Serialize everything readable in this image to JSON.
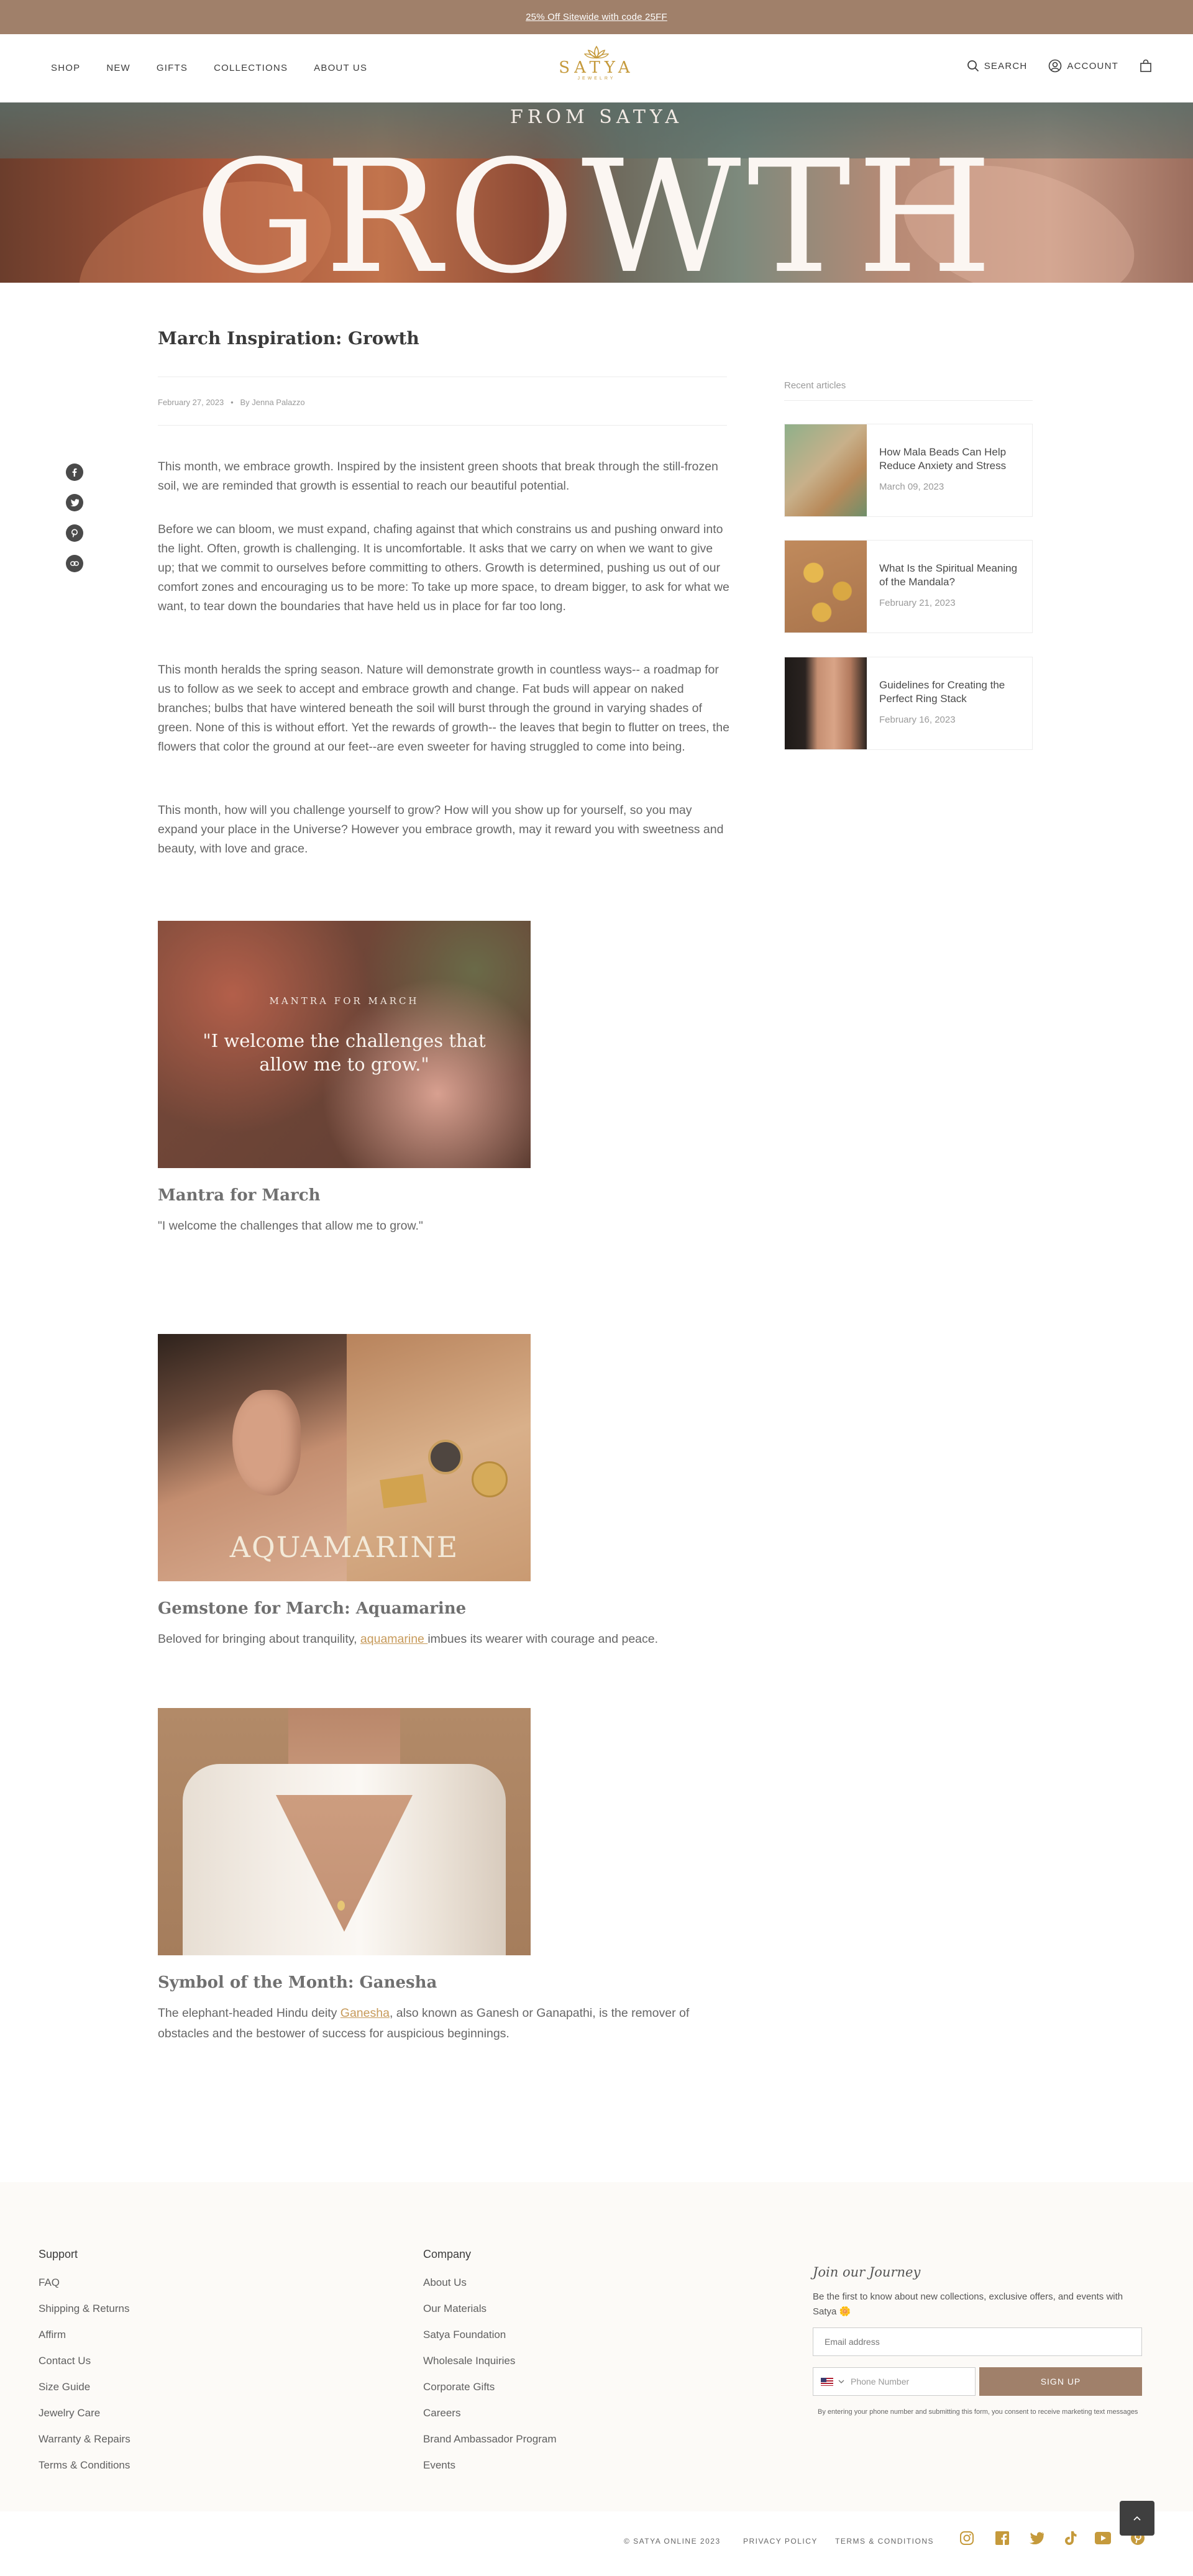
{
  "announcement": {
    "text": "25% Off Sitewide with code 25FF"
  },
  "nav": {
    "left": [
      "SHOP",
      "NEW",
      "GIFTS",
      "COLLECTIONS",
      "ABOUT US"
    ],
    "logo": {
      "name": "SATYA",
      "sub": "JEWELRY"
    },
    "search_label": "SEARCH",
    "account_label": "ACCOUNT"
  },
  "hero": {
    "eyebrow": "FROM SATYA",
    "title": "GROWTH"
  },
  "article": {
    "title": "March Inspiration: Growth",
    "date": "February 27, 2023",
    "author": "By Jenna Palazzo",
    "paragraphs": [
      "This month, we embrace growth. Inspired by the insistent green shoots that break through the still-frozen soil, we are reminded that growth is essential to reach our beautiful potential.",
      "Before we can bloom, we must expand, chafing against that which constrains us and pushing onward into the light. Often, growth is challenging. It is uncomfortable. It asks that we carry on when we want to give up; that we commit to ourselves before committing to others. Growth is determined, pushing us out of our comfort zones and encouraging us to be more: To take up more space, to dream bigger, to ask for what we want, to tear down the boundaries that have held us in place for far too long.",
      "This month heralds the spring season. Nature will demonstrate growth in countless ways-- a roadmap for us to follow as we seek to accept and embrace growth and change. Fat buds will appear on naked branches; bulbs that have wintered beneath the soil will burst through the ground in varying shades of green. None of this is without effort. Yet the rewards of growth-- the leaves that begin to flutter on trees, the flowers that color the ground at our feet--are even sweeter for having struggled to come into being.",
      "This month, how will you challenge yourself to grow? How will you show up for yourself, so you may expand your place in the Universe? However you embrace growth, may it reward you with sweetness and beauty, with love and grace."
    ],
    "mantra_image": {
      "kicker": "MANTRA FOR MARCH",
      "quote": "\"I welcome the challenges that allow me to grow.\""
    },
    "mantra": {
      "heading": "Mantra for March",
      "text": "\"I welcome the challenges that allow me to grow.\""
    },
    "gem_image_word": "AQUAMARINE",
    "gem": {
      "heading": "Gemstone for March: Aquamarine",
      "pre": "Beloved for bringing about tranquility, ",
      "link": "aquamarine ",
      "post": "imbues its wearer with courage and peace."
    },
    "symbol": {
      "heading": "Symbol of the Month: Ganesha",
      "pre": "The elephant-headed Hindu deity ",
      "link": "Ganesha",
      "post": ", also known as Ganesh or Ganapathi, is the remover of obstacles and the bestower of success for auspicious beginnings."
    }
  },
  "sidebar": {
    "title": "Recent articles",
    "articles": [
      {
        "title": "How Mala Beads Can Help Reduce Anxiety and Stress",
        "date": "March 09, 2023"
      },
      {
        "title": "What Is the Spiritual Meaning of the Mandala?",
        "date": "February 21, 2023"
      },
      {
        "title": "Guidelines for Creating the Perfect Ring Stack",
        "date": "February 16, 2023"
      }
    ]
  },
  "footer": {
    "support": {
      "heading": "Support",
      "links": [
        "FAQ",
        "Shipping & Returns",
        "Affirm",
        "Contact Us",
        "Size Guide",
        "Jewelry Care",
        "Warranty & Repairs",
        "Terms & Conditions"
      ]
    },
    "company": {
      "heading": "Company",
      "links": [
        "About Us",
        "Our Materials",
        "Satya Foundation",
        "Wholesale Inquiries",
        "Corporate Gifts",
        "Careers",
        "Brand Ambassador Program",
        "Events"
      ]
    },
    "join": {
      "heading": "Join our Journey",
      "text": "Be the first to know about new collections, exclusive offers, and events with Satya 🌼",
      "email_placeholder": "Email address",
      "phone_placeholder": "Phone Number",
      "signup": "SIGN UP",
      "consent": "By entering your phone number and submitting this form, you consent to receive marketing text messages"
    },
    "bottom": {
      "copyright": "© SATYA ONLINE 2023",
      "privacy": "PRIVACY POLICY",
      "terms": "TERMS & CONDITIONS"
    }
  },
  "colors": {
    "brand": "#a0806a",
    "gold": "#c59a3c",
    "link": "#c79a5a"
  },
  "icons": [
    "search-icon",
    "account-icon",
    "cart-icon",
    "facebook-icon",
    "twitter-icon",
    "pinterest-icon",
    "link-icon",
    "instagram-icon",
    "tiktok-icon",
    "youtube-icon",
    "arrow-up-icon"
  ]
}
